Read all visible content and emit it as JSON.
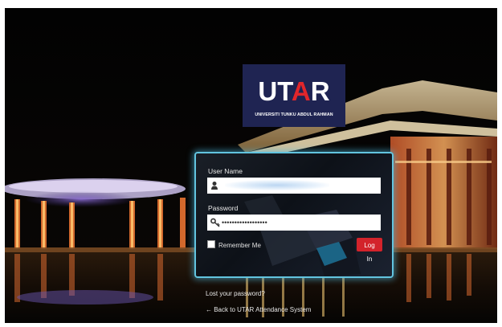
{
  "brand": {
    "logo_text": "UTAR",
    "logo_subtitle": "UNIVERSITI TUNKU ABDUL RAHMAN",
    "logo_colors": {
      "background": "#1f2452",
      "text": "#ffffff",
      "accent": "#e0262b"
    }
  },
  "login": {
    "username_label": "User Name",
    "username_value": "",
    "password_label": "Password",
    "password_value": "••••••••••••••••••",
    "remember_label": "Remember Me",
    "login_button": "Log In",
    "accent_color": "#d3232b",
    "frame_color": "#62c4df"
  },
  "links": {
    "lost_password": "Lost your password?",
    "back_to_site": "← Back to UTAR Attendance System"
  },
  "icons": {
    "username": "user-icon",
    "password": "key-icon"
  }
}
